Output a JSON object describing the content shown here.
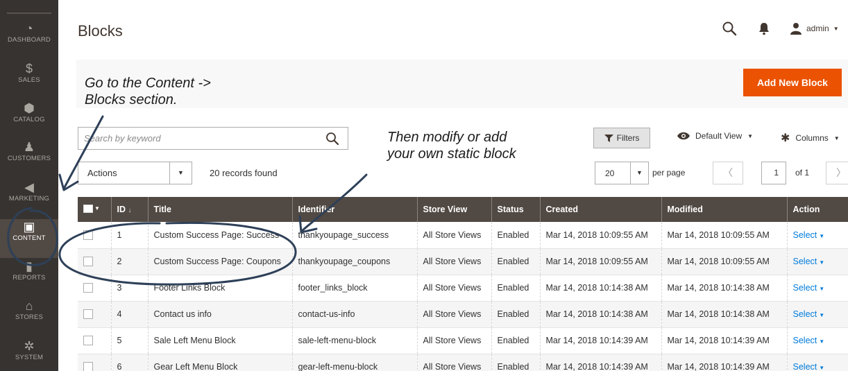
{
  "sidebar": {
    "items": [
      {
        "label": "DASHBOARD",
        "icon": "dashboard-icon",
        "glyph": "◔"
      },
      {
        "label": "SALES",
        "icon": "dollar-icon",
        "glyph": "$"
      },
      {
        "label": "CATALOG",
        "icon": "cube-icon",
        "glyph": "⬢"
      },
      {
        "label": "CUSTOMERS",
        "icon": "person-icon",
        "glyph": "♟"
      },
      {
        "label": "MARKETING",
        "icon": "megaphone-icon",
        "glyph": "◀"
      },
      {
        "label": "CONTENT",
        "icon": "layout-icon",
        "glyph": "▣",
        "active": true
      },
      {
        "label": "REPORTS",
        "icon": "bar-chart-icon",
        "glyph": "▮"
      },
      {
        "label": "STORES",
        "icon": "storefront-icon",
        "glyph": "⌂"
      },
      {
        "label": "SYSTEM",
        "icon": "gear-icon",
        "glyph": "✲"
      }
    ]
  },
  "header": {
    "title": "Blocks",
    "user": "admin"
  },
  "page_actions": {
    "add_new": "Add New Block"
  },
  "annotations": {
    "step1": "Go to the Content ->\nBlocks section.",
    "step2": "Then modify or add\nyour own static block"
  },
  "toolbar": {
    "search_placeholder": "Search by keyword",
    "filters": "Filters",
    "view": "Default View",
    "columns": "Columns",
    "actions": "Actions",
    "records_found": "20 records found",
    "per_page_value": "20",
    "per_page_label": "per page",
    "page_current": "1",
    "page_of": "of 1"
  },
  "grid": {
    "columns": [
      "ID",
      "Title",
      "Identifier",
      "Store View",
      "Status",
      "Created",
      "Modified",
      "Action"
    ],
    "sort_indicator": "↓",
    "rows": [
      {
        "id": "1",
        "title": "Custom Success Page: Success",
        "identifier": "thankyoupage_success",
        "store_view": "All Store Views",
        "status": "Enabled",
        "created": "Mar 14, 2018 10:09:55 AM",
        "modified": "Mar 14, 2018 10:09:55 AM",
        "action": "Select"
      },
      {
        "id": "2",
        "title": "Custom Success Page: Coupons",
        "identifier": "thankyoupage_coupons",
        "store_view": "All Store Views",
        "status": "Enabled",
        "created": "Mar 14, 2018 10:09:55 AM",
        "modified": "Mar 14, 2018 10:09:55 AM",
        "action": "Select"
      },
      {
        "id": "3",
        "title": "Footer Links Block",
        "identifier": "footer_links_block",
        "store_view": "All Store Views",
        "status": "Enabled",
        "created": "Mar 14, 2018 10:14:38 AM",
        "modified": "Mar 14, 2018 10:14:38 AM",
        "action": "Select"
      },
      {
        "id": "4",
        "title": "Contact us info",
        "identifier": "contact-us-info",
        "store_view": "All Store Views",
        "status": "Enabled",
        "created": "Mar 14, 2018 10:14:38 AM",
        "modified": "Mar 14, 2018 10:14:38 AM",
        "action": "Select"
      },
      {
        "id": "5",
        "title": "Sale Left Menu Block",
        "identifier": "sale-left-menu-block",
        "store_view": "All Store Views",
        "status": "Enabled",
        "created": "Mar 14, 2018 10:14:39 AM",
        "modified": "Mar 14, 2018 10:14:39 AM",
        "action": "Select"
      },
      {
        "id": "6",
        "title": "Gear Left Menu Block",
        "identifier": "gear-left-menu-block",
        "store_view": "All Store Views",
        "status": "Enabled",
        "created": "Mar 14, 2018 10:14:39 AM",
        "modified": "Mar 14, 2018 10:14:39 AM",
        "action": "Select"
      }
    ]
  },
  "colors": {
    "sidebar_bg": "#373330",
    "header_row_bg": "#514943",
    "accent": "#eb5202",
    "link": "#007bdb"
  }
}
